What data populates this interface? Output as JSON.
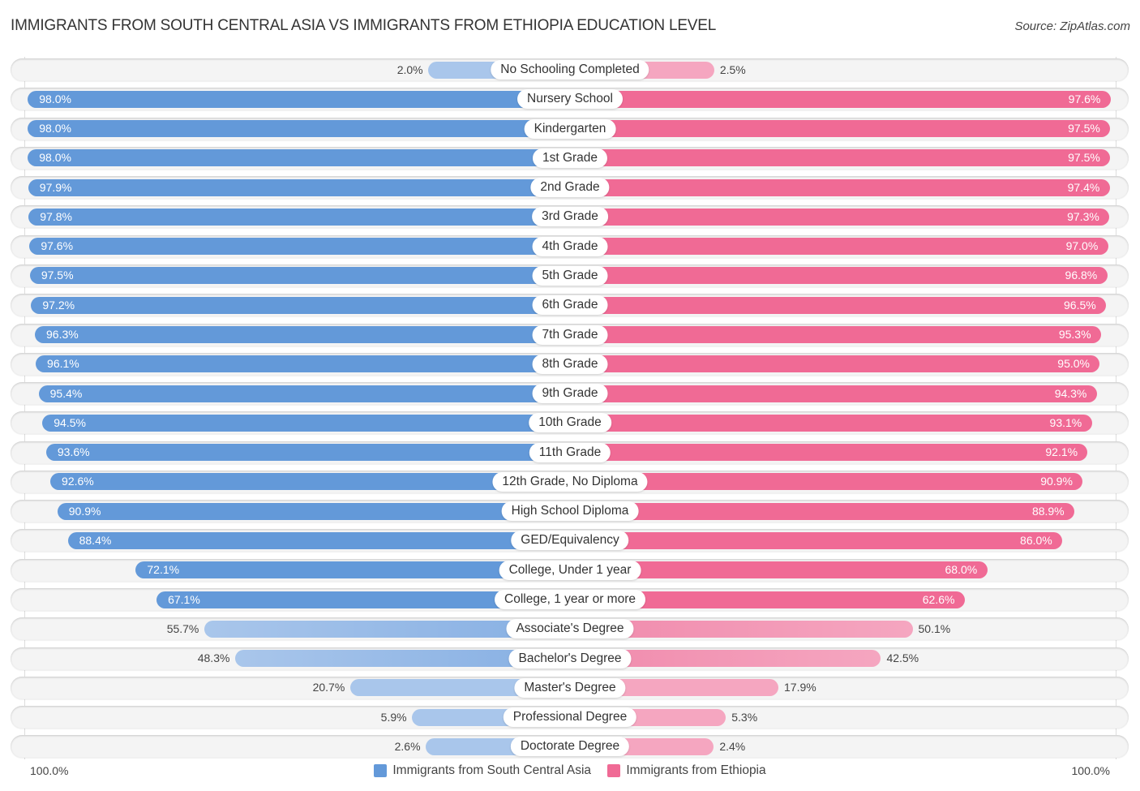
{
  "header": {
    "title": "IMMIGRANTS FROM SOUTH CENTRAL ASIA VS IMMIGRANTS FROM ETHIOPIA EDUCATION LEVEL",
    "source": "Source: ZipAtlas.com"
  },
  "colors": {
    "left_strong": "#6399d9",
    "left_light": "#a9c6eb",
    "right_strong": "#f06a95",
    "right_light": "#f5a6c0"
  },
  "axis": {
    "left_label": "100.0%",
    "right_label": "100.0%"
  },
  "legend": [
    {
      "label": "Immigrants from South Central Asia",
      "color": "#6399d9"
    },
    {
      "label": "Immigrants from Ethiopia",
      "color": "#f06a95"
    }
  ],
  "chart_data": {
    "type": "bar",
    "orientation": "horizontal-diverging",
    "title": "IMMIGRANTS FROM SOUTH CENTRAL ASIA VS IMMIGRANTS FROM ETHIOPIA EDUCATION LEVEL",
    "xlim": [
      0,
      100
    ],
    "unit": "%",
    "categories": [
      "No Schooling Completed",
      "Nursery School",
      "Kindergarten",
      "1st Grade",
      "2nd Grade",
      "3rd Grade",
      "4th Grade",
      "5th Grade",
      "6th Grade",
      "7th Grade",
      "8th Grade",
      "9th Grade",
      "10th Grade",
      "11th Grade",
      "12th Grade, No Diploma",
      "High School Diploma",
      "GED/Equivalency",
      "College, Under 1 year",
      "College, 1 year or more",
      "Associate's Degree",
      "Bachelor's Degree",
      "Master's Degree",
      "Professional Degree",
      "Doctorate Degree"
    ],
    "series": [
      {
        "name": "Immigrants from South Central Asia",
        "side": "left",
        "values": [
          2.0,
          98.0,
          98.0,
          98.0,
          97.9,
          97.8,
          97.6,
          97.5,
          97.2,
          96.3,
          96.1,
          95.4,
          94.5,
          93.6,
          92.6,
          90.9,
          88.4,
          72.1,
          67.1,
          55.7,
          48.3,
          20.7,
          5.9,
          2.6
        ],
        "labels": [
          "2.0%",
          "98.0%",
          "98.0%",
          "98.0%",
          "97.9%",
          "97.8%",
          "97.6%",
          "97.5%",
          "97.2%",
          "96.3%",
          "96.1%",
          "95.4%",
          "94.5%",
          "93.6%",
          "92.6%",
          "90.9%",
          "88.4%",
          "72.1%",
          "67.1%",
          "55.7%",
          "48.3%",
          "20.7%",
          "5.9%",
          "2.6%"
        ]
      },
      {
        "name": "Immigrants from Ethiopia",
        "side": "right",
        "values": [
          2.5,
          97.6,
          97.5,
          97.5,
          97.4,
          97.3,
          97.0,
          96.8,
          96.5,
          95.3,
          95.0,
          94.3,
          93.1,
          92.1,
          90.9,
          88.9,
          86.0,
          68.0,
          62.6,
          50.1,
          42.5,
          17.9,
          5.3,
          2.4
        ],
        "labels": [
          "2.5%",
          "97.6%",
          "97.5%",
          "97.5%",
          "97.4%",
          "97.3%",
          "97.0%",
          "96.8%",
          "96.5%",
          "95.3%",
          "95.0%",
          "94.3%",
          "93.1%",
          "92.1%",
          "90.9%",
          "88.9%",
          "86.0%",
          "68.0%",
          "62.6%",
          "50.1%",
          "42.5%",
          "17.9%",
          "5.3%",
          "2.4%"
        ]
      }
    ],
    "axis_labels": {
      "left": "100.0%",
      "right": "100.0%"
    },
    "legend_position": "bottom-center",
    "grid": false
  }
}
